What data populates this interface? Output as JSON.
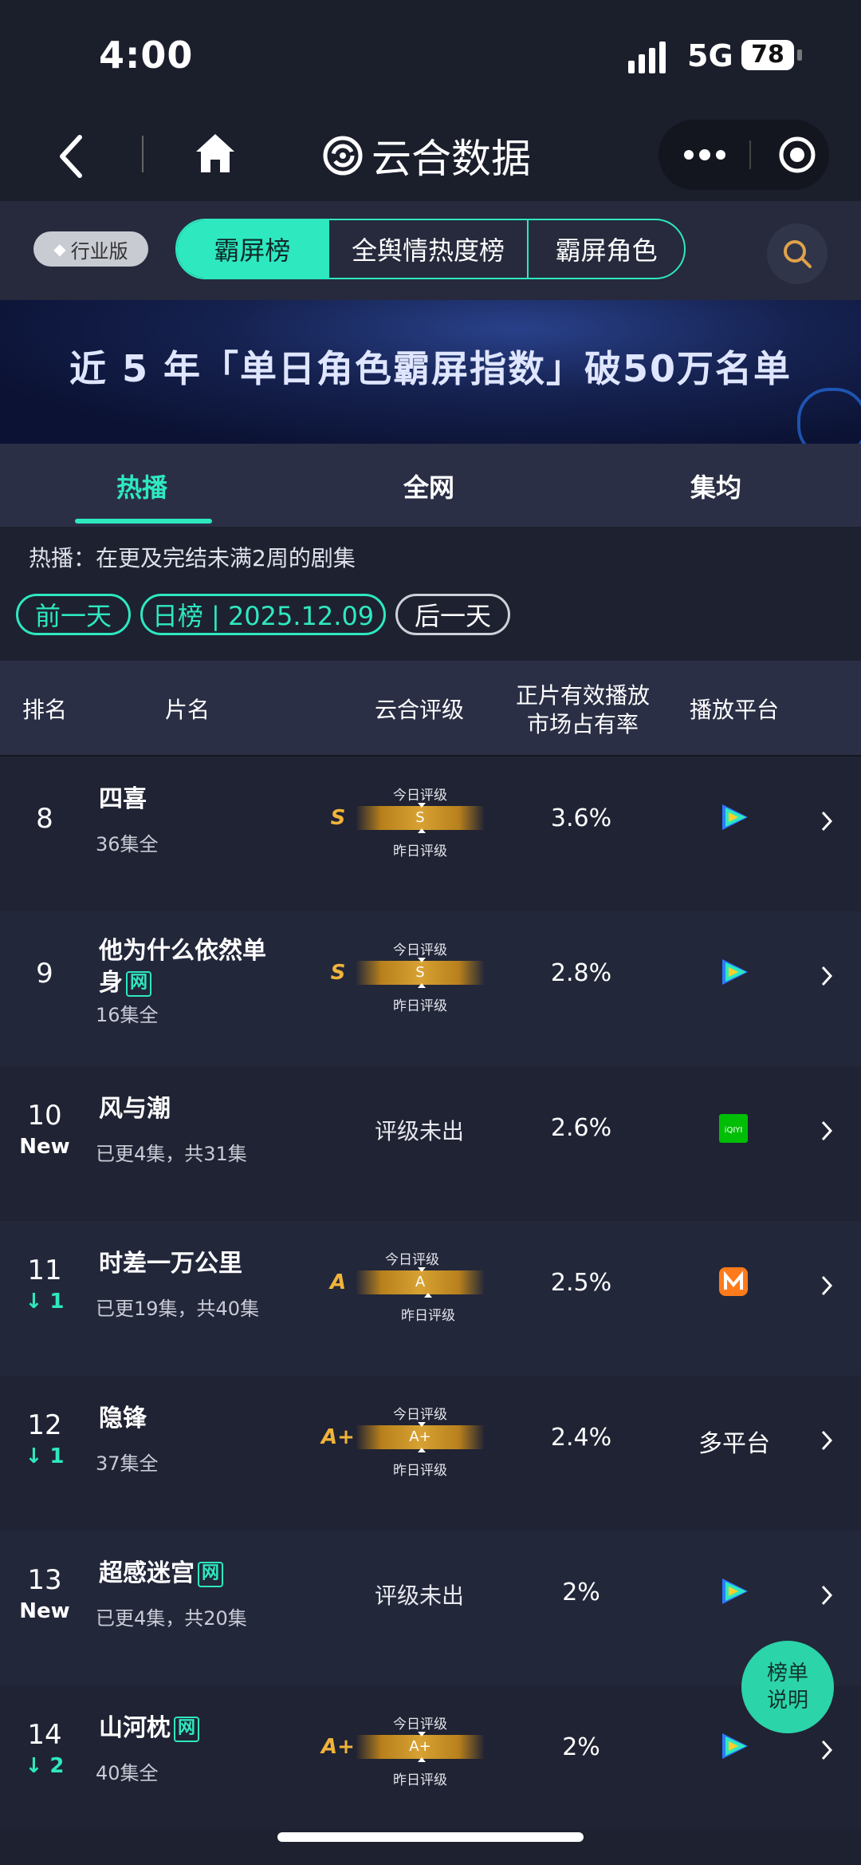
{
  "status": {
    "time": "4:00",
    "network": "5G",
    "battery": "78"
  },
  "nav": {
    "brand": "云合数据"
  },
  "filter": {
    "badge": "行业版",
    "segments": [
      "霸屏榜",
      "全舆情热度榜",
      "霸屏角色"
    ]
  },
  "banner": {
    "text": "近 5 年「单日角色霸屏指数」破50万名单"
  },
  "subtabs": [
    "热播",
    "全网",
    "集均"
  ],
  "description": "热播：在更及完结未满2周的剧集",
  "date_controls": {
    "prev": "前一天",
    "current": "日榜 | 2025.12.09",
    "next": "后一天"
  },
  "table": {
    "headers": {
      "rank": "排名",
      "title": "片名",
      "rating": "云合评级",
      "share_line1": "正片有效播放",
      "share_line2": "市场占有率",
      "platform": "播放平台"
    },
    "today_label": "今日评级",
    "yesterday_label": "昨日评级",
    "rows": [
      {
        "rank": "8",
        "rank_change": "",
        "title": "四喜",
        "network_tag": "",
        "episodes": "36集全",
        "grade": "S",
        "bar_grade": "S",
        "no_rating": "",
        "share": "3.6%",
        "platform": "tencent-video-icon",
        "platform_text": ""
      },
      {
        "rank": "9",
        "rank_change": "",
        "title": "他为什么依然单身",
        "network_tag": "网",
        "episodes": "16集全",
        "grade": "S",
        "bar_grade": "S",
        "no_rating": "",
        "share": "2.8%",
        "platform": "tencent-video-icon",
        "platform_text": ""
      },
      {
        "rank": "10",
        "rank_change": "New",
        "title": "风与潮",
        "network_tag": "",
        "episodes": "已更4集，共31集",
        "grade": "",
        "bar_grade": "",
        "no_rating": "评级未出",
        "share": "2.6%",
        "platform": "iqiyi-icon",
        "platform_text": ""
      },
      {
        "rank": "11",
        "rank_change": "1",
        "title": "时差一万公里",
        "network_tag": "",
        "episodes": "已更19集，共40集",
        "grade": "A",
        "bar_grade": "A",
        "no_rating": "",
        "share": "2.5%",
        "platform": "mango-tv-icon",
        "platform_text": ""
      },
      {
        "rank": "12",
        "rank_change": "1",
        "title": "隐锋",
        "network_tag": "",
        "episodes": "37集全",
        "grade": "A+",
        "bar_grade": "A+",
        "no_rating": "",
        "share": "2.4%",
        "platform": "",
        "platform_text": "多平台"
      },
      {
        "rank": "13",
        "rank_change": "New",
        "title": "超感迷宫",
        "network_tag": "网",
        "episodes": "已更4集，共20集",
        "grade": "",
        "bar_grade": "",
        "no_rating": "评级未出",
        "share": "2%",
        "platform": "tencent-video-icon",
        "platform_text": ""
      },
      {
        "rank": "14",
        "rank_change": "2",
        "title": "山河枕",
        "network_tag": "网",
        "episodes": "40集全",
        "grade": "A+",
        "bar_grade": "A+",
        "no_rating": "",
        "share": "2%",
        "platform": "tencent-video-icon",
        "platform_text": ""
      }
    ]
  },
  "float_button": {
    "line1": "榜单",
    "line2": "说明"
  },
  "colors": {
    "accent": "#2ee8c0",
    "gold": "#d8a233",
    "bg": "#1e2130"
  }
}
